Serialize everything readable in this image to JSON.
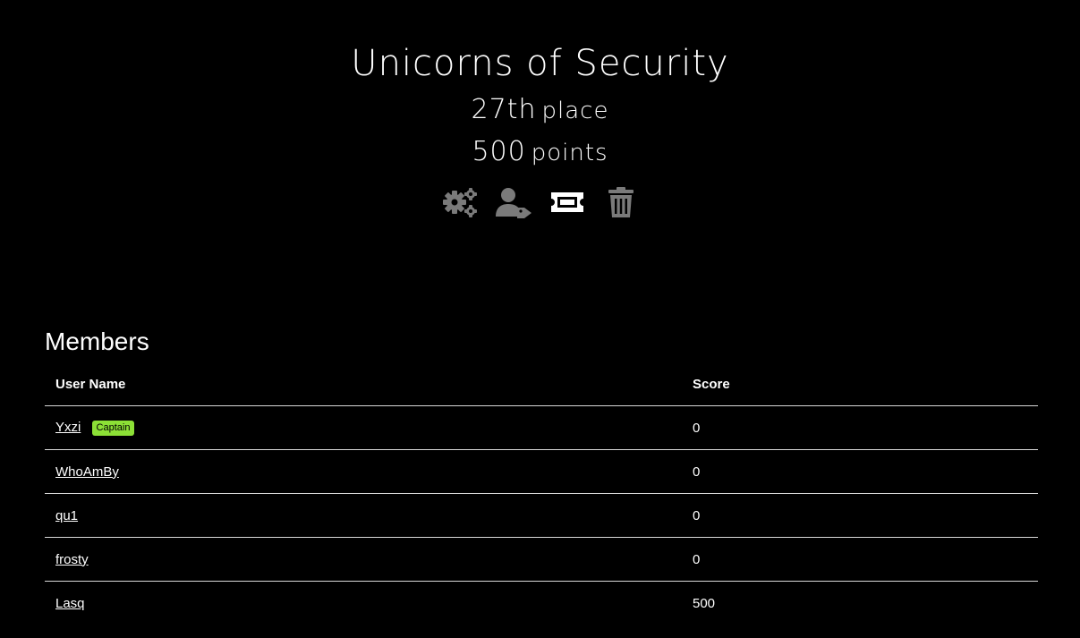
{
  "team": {
    "name": "Unicorns of Security",
    "rank": "27th",
    "rank_suffix": "place",
    "points": "500",
    "points_suffix": "points"
  },
  "actions": [
    {
      "icon": "gears-icon"
    },
    {
      "icon": "user-tag-icon"
    },
    {
      "icon": "ticket-icon"
    },
    {
      "icon": "trash-icon"
    }
  ],
  "members": {
    "title": "Members",
    "columns": {
      "user": "User Name",
      "score": "Score"
    },
    "captain_badge": "Captain",
    "rows": [
      {
        "name": "Yxzi",
        "score": "0"
      },
      {
        "name": "WhoAmBy",
        "score": "0"
      },
      {
        "name": "qu1",
        "score": "0"
      },
      {
        "name": "frosty",
        "score": "0"
      },
      {
        "name": "Lasq",
        "score": "500"
      }
    ]
  },
  "colors": {
    "background": "#000000",
    "text": "#ffffff",
    "icon_gray": "#7a7a7a",
    "badge": "#8ce036"
  }
}
